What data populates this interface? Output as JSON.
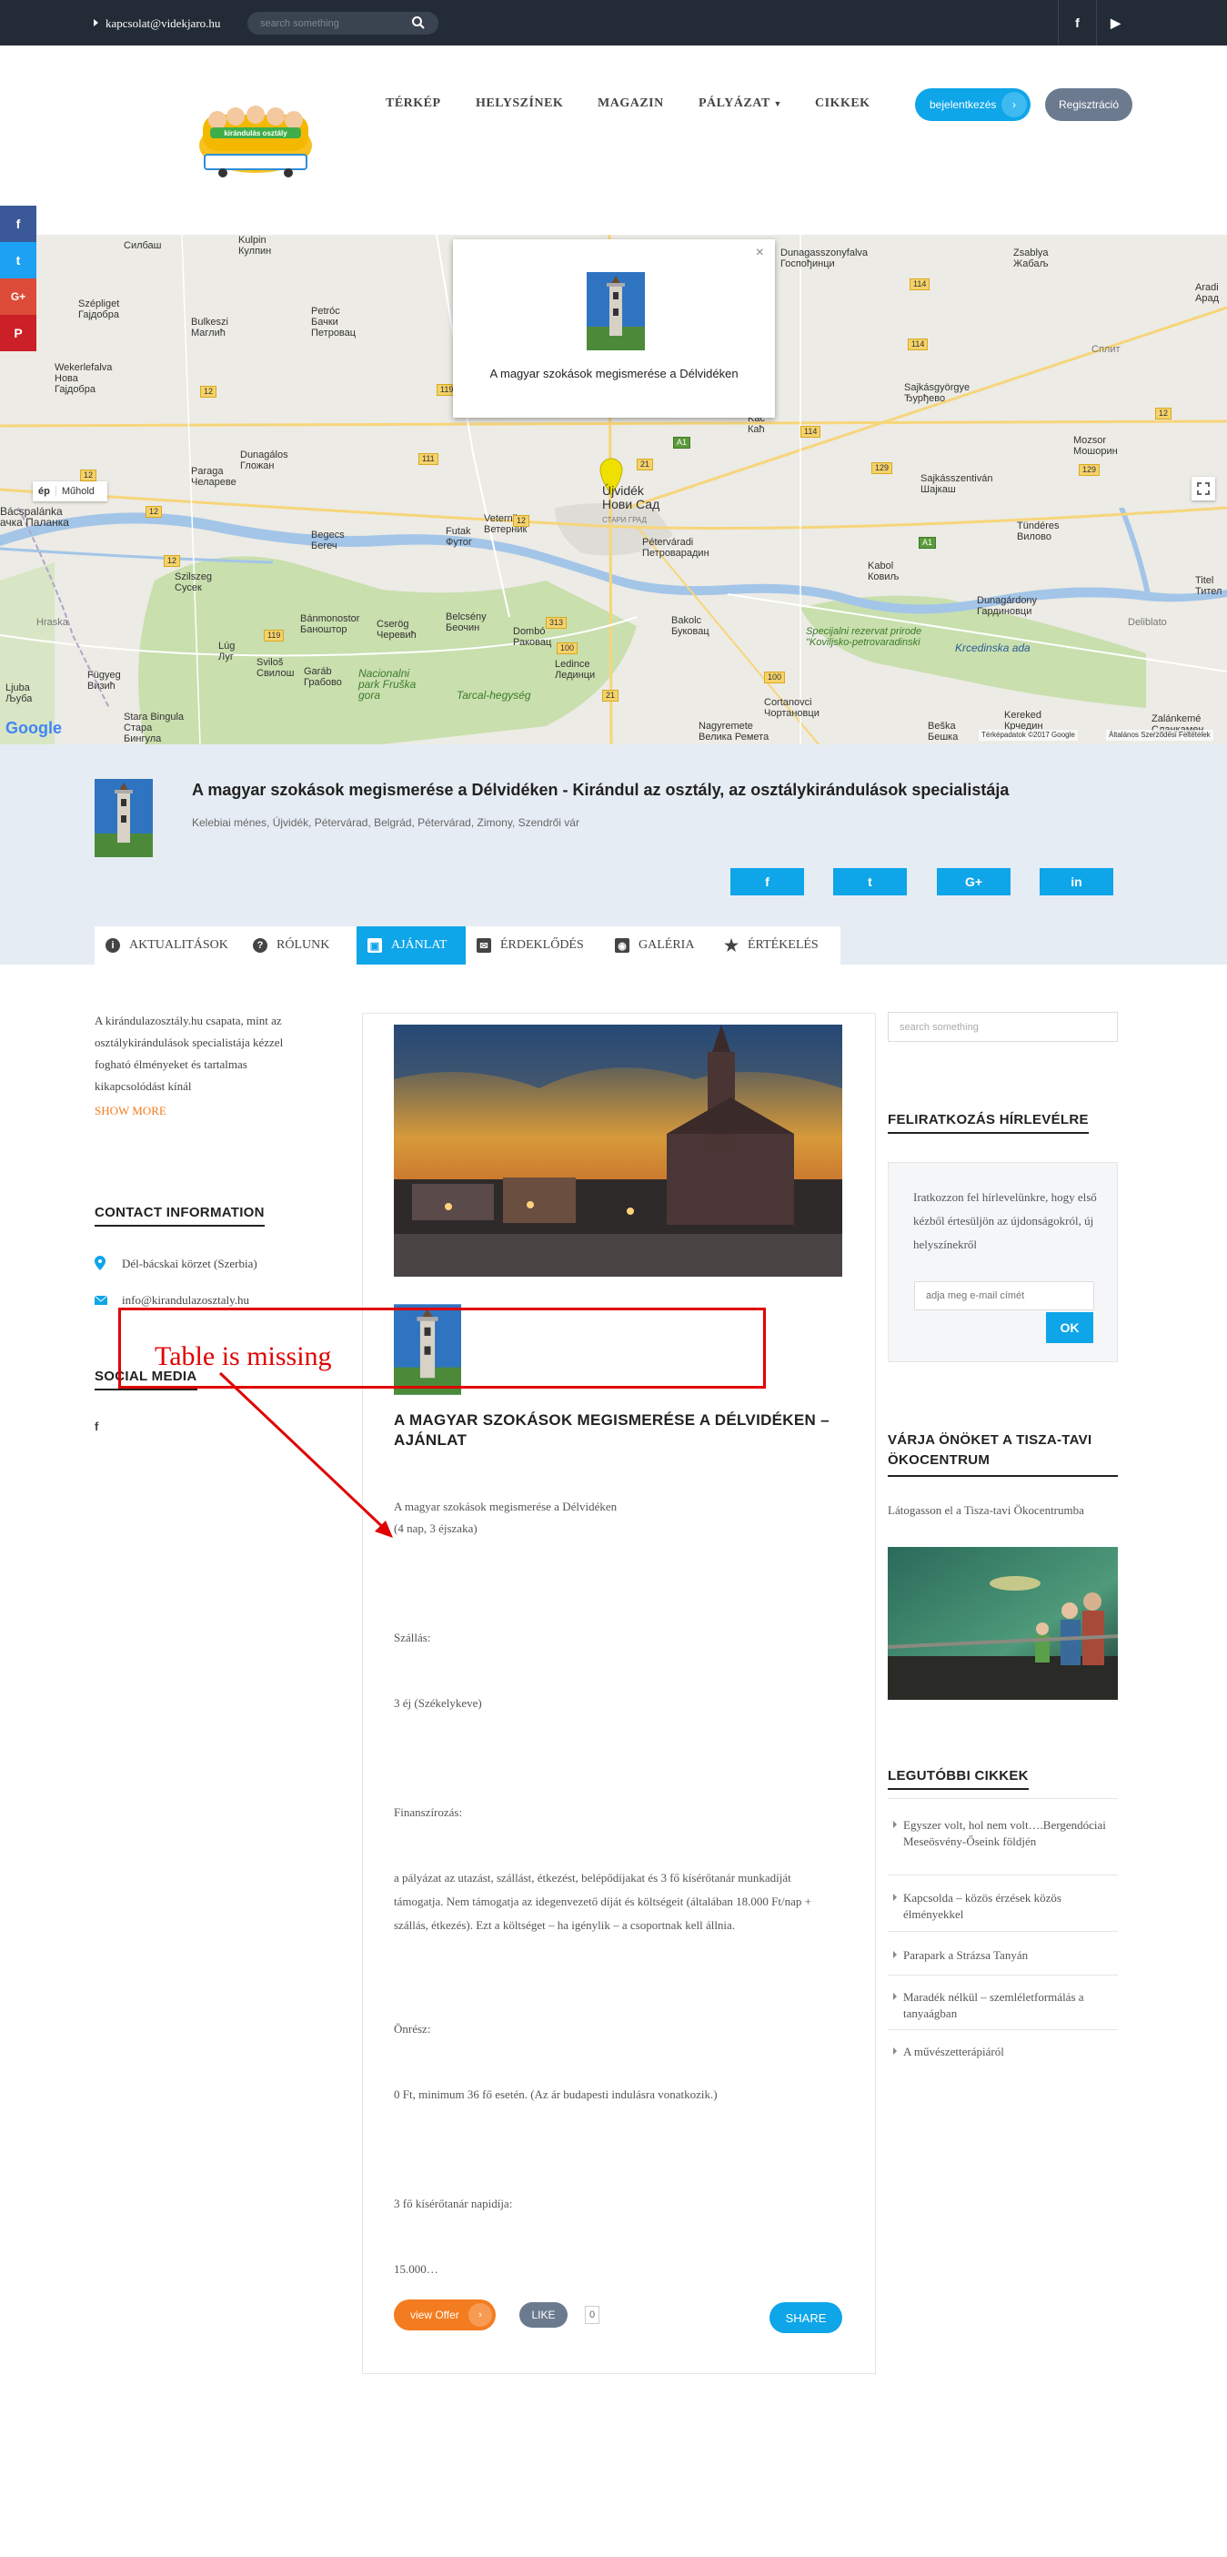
{
  "topbar": {
    "email": "kapcsolat@videkjaro.hu",
    "search_placeholder": "search something",
    "social": [
      "f",
      "▶"
    ]
  },
  "header": {
    "logo_text": "kirándulás osztály",
    "nav": [
      "TÉRKÉP",
      "HELYSZÍNEK",
      "MAGAZIN",
      "PÁLYÁZAT",
      "CIKKEK"
    ],
    "login_label": "bejelentkezés",
    "register_label": "Regisztráció"
  },
  "share_sidebar": [
    "f",
    "t",
    "G+",
    "P"
  ],
  "map": {
    "type_partial": "ép",
    "type_satellite": "Műhold",
    "popup_caption": "A magyar szokások megismerése a Délvidéken",
    "attribution": "Térképadatok ©2017 Google",
    "terms": "Általános Szerződési Feltételek",
    "google": "Google",
    "places": [
      {
        "name": "Силбаш"
      },
      {
        "name": "Kulpin\nКулпин"
      },
      {
        "name": "Szépliget\nГајдобра"
      },
      {
        "name": "Petróc\nБачки\nПетровац"
      },
      {
        "name": "Bulkeszi\nМаглић"
      },
      {
        "name": "Wekerlefalva\nНова\nГајдобра"
      },
      {
        "name": "Dunagálos\nГложан"
      },
      {
        "name": "Paraga\nЧелареве"
      },
      {
        "name": "Bácspalánka\nачка Паланка"
      },
      {
        "name": "Begecs\nБегеч"
      },
      {
        "name": "Futak\nФутог"
      },
      {
        "name": "Veternik\nВетерник"
      },
      {
        "name": "Újvidék\nНови Сад"
      },
      {
        "name": "Péterváradi\nПетроварадин"
      },
      {
        "name": "Szilszeg\nСусек"
      },
      {
        "name": "Bánmonostor\nБаноштор"
      },
      {
        "name": "Cserög\nЧеревић"
      },
      {
        "name": "Belcsény\nБеочин"
      },
      {
        "name": "Dombó\nРаковац"
      },
      {
        "name": "Ledince\nЛединци"
      },
      {
        "name": "Bakolc\nБуковац"
      },
      {
        "name": "Lúg\nЛуг"
      },
      {
        "name": "Sviloš\nСвилош"
      },
      {
        "name": "Garáb\nГрабово"
      },
      {
        "name": "Nacionalni\npark Fruška\ngora"
      },
      {
        "name": "Tarcal-hegység"
      },
      {
        "name": "Fügyeg\nВизић"
      },
      {
        "name": "Ljuba\nЉуба"
      },
      {
        "name": "Stara Bingula\nСтара\nБингула"
      },
      {
        "name": "Cortanovci\nЧортановци"
      },
      {
        "name": "Nagyremete\nВелика Ремета"
      },
      {
        "name": "Beška\nБешка"
      },
      {
        "name": "Kereked\nКрчедин"
      },
      {
        "name": "Kabol\nКовиљ"
      },
      {
        "name": "Dunagárdony\nГардиновци"
      },
      {
        "name": "Sajkásszentiván\nШајкаш"
      },
      {
        "name": "Sajkásgyörgye\nЂурђево"
      },
      {
        "name": "Tündéres\nВилово"
      },
      {
        "name": "Mozsor\nМошорин"
      },
      {
        "name": "Kać\nКаћ"
      },
      {
        "name": "Dunagasszonyfalva\nГоспођинци"
      },
      {
        "name": "Zsablya\nЖабаљ"
      },
      {
        "name": "Aradi\nАрад"
      },
      {
        "name": "Titel\nТител"
      },
      {
        "name": "Zalánkemé\nСланкамен"
      },
      {
        "name": "Specijalni rezervat prirode\n\"Koviljsko-petrovaradinski"
      },
      {
        "name": "Krcedinska ada"
      },
      {
        "name": "Сплит"
      },
      {
        "name": "Deliblato"
      },
      {
        "name": "Hraska"
      },
      {
        "name": "СТАРИ ГРАД"
      }
    ],
    "road_numbers": [
      "12",
      "119",
      "12",
      "111",
      "12",
      "114",
      "114",
      "129",
      "129",
      "100",
      "12",
      "12",
      "313",
      "100",
      "21",
      "119",
      "21",
      "12",
      "A1",
      "A1",
      "114"
    ]
  },
  "profile": {
    "title": "A magyar szokások megismerése a Délvidéken - Kirándul az osztály, az osztálykirándulások specialistája",
    "subtitle": "Kelebiai ménes, Újvidék, Pétervárad, Belgrád, Pétervárad, Zimony, Szendrői vár",
    "social": [
      "f",
      "t",
      "G+",
      "in"
    ]
  },
  "tabs": [
    "AKTUALITÁSOK",
    "RÓLUNK",
    "AJÁNLAT",
    "ÉRDEKLŐDÉS",
    "GALÉRIA",
    "ÉRTÉKELÉS"
  ],
  "left": {
    "about": "A kirándulazosztály.hu csapata, mint az osztálykirándulások specialistája kézzel fogható élményeket és tartalmas kikapcsolódást kínál",
    "show_more": "SHOW MORE",
    "contact_heading": "CONTACT INFORMATION",
    "address": "Dél-bácskai körzet (Szerbia)",
    "email": "info@kirandulazosztaly.hu",
    "social_heading": "SOCIAL MEDIA",
    "social_icon": "f"
  },
  "offer": {
    "title": "A MAGYAR SZOKÁSOK MEGISMERÉSE A DÉLVIDÉKEN – AJÁNLAT",
    "intro_line1": "A magyar szokások megismerése a Délvidéken",
    "intro_line2": " (4 nap, 3 éjszaka)",
    "szallas_label": "Szállás:",
    "szallas_value": "3 éj (Székelykeve)",
    "finansz_label": "Finanszírozás:",
    "finansz_value": "a pályázat az utazást, szállást, étkezést, belépődíjakat és 3 fő kísérőtanár munkadíját támogatja. Nem támogatja az idegenvezető díját és költségeit (általában 18.000 Ft/nap + szállás, étkezés). Ezt a költséget – ha igénylik – a csoportnak kell állnia.",
    "onresz_label": "Önrész:",
    "onresz_value": "0 Ft, minimum 36 fő esetén.   (Az ár budapesti indulásra vonatkozik.)",
    "kisero_label": "3 fő kísérőtanár napidíja:",
    "kisero_value": "15.000…",
    "view_label": "view Offer",
    "like_label": "LIKE",
    "like_count": "0",
    "share_label": "SHARE"
  },
  "annotation": {
    "text": "Table is missing",
    "color": "#e00000"
  },
  "right": {
    "search_placeholder": "search something",
    "newsletter_heading": "FELIRATKOZÁS HÍRLEVÉLRE",
    "newsletter_text": "Iratkozzon fel hírlevelünkre, hogy első kézből értesüljön az újdonságokról, új helyszínekről",
    "newsletter_placeholder": "adja meg e-mail címét",
    "newsletter_button": "OK",
    "promo_heading": "VÁRJA ÖNÖKET A TISZA-TAVI ÖKOCENTRUM",
    "promo_text": "Látogasson el a Tisza-tavi Ökocentrumba",
    "recent_heading": "LEGUTÓBBI CIKKEK",
    "recent": [
      "Egyszer volt, hol nem volt….Bergendóciai Meseösvény-Őseink földjén",
      "Kapcsolda – közös érzések közös élményekkel",
      "Parapark a Strázsa Tanyán",
      "Maradék nélkül – szemléletformálás a tanyaágban",
      "A művészetterápiáról"
    ]
  },
  "colors": {
    "accent": "#0ea5e9",
    "orange": "#f47c20",
    "topbar": "#232b36",
    "band": "#e6ecf3"
  }
}
